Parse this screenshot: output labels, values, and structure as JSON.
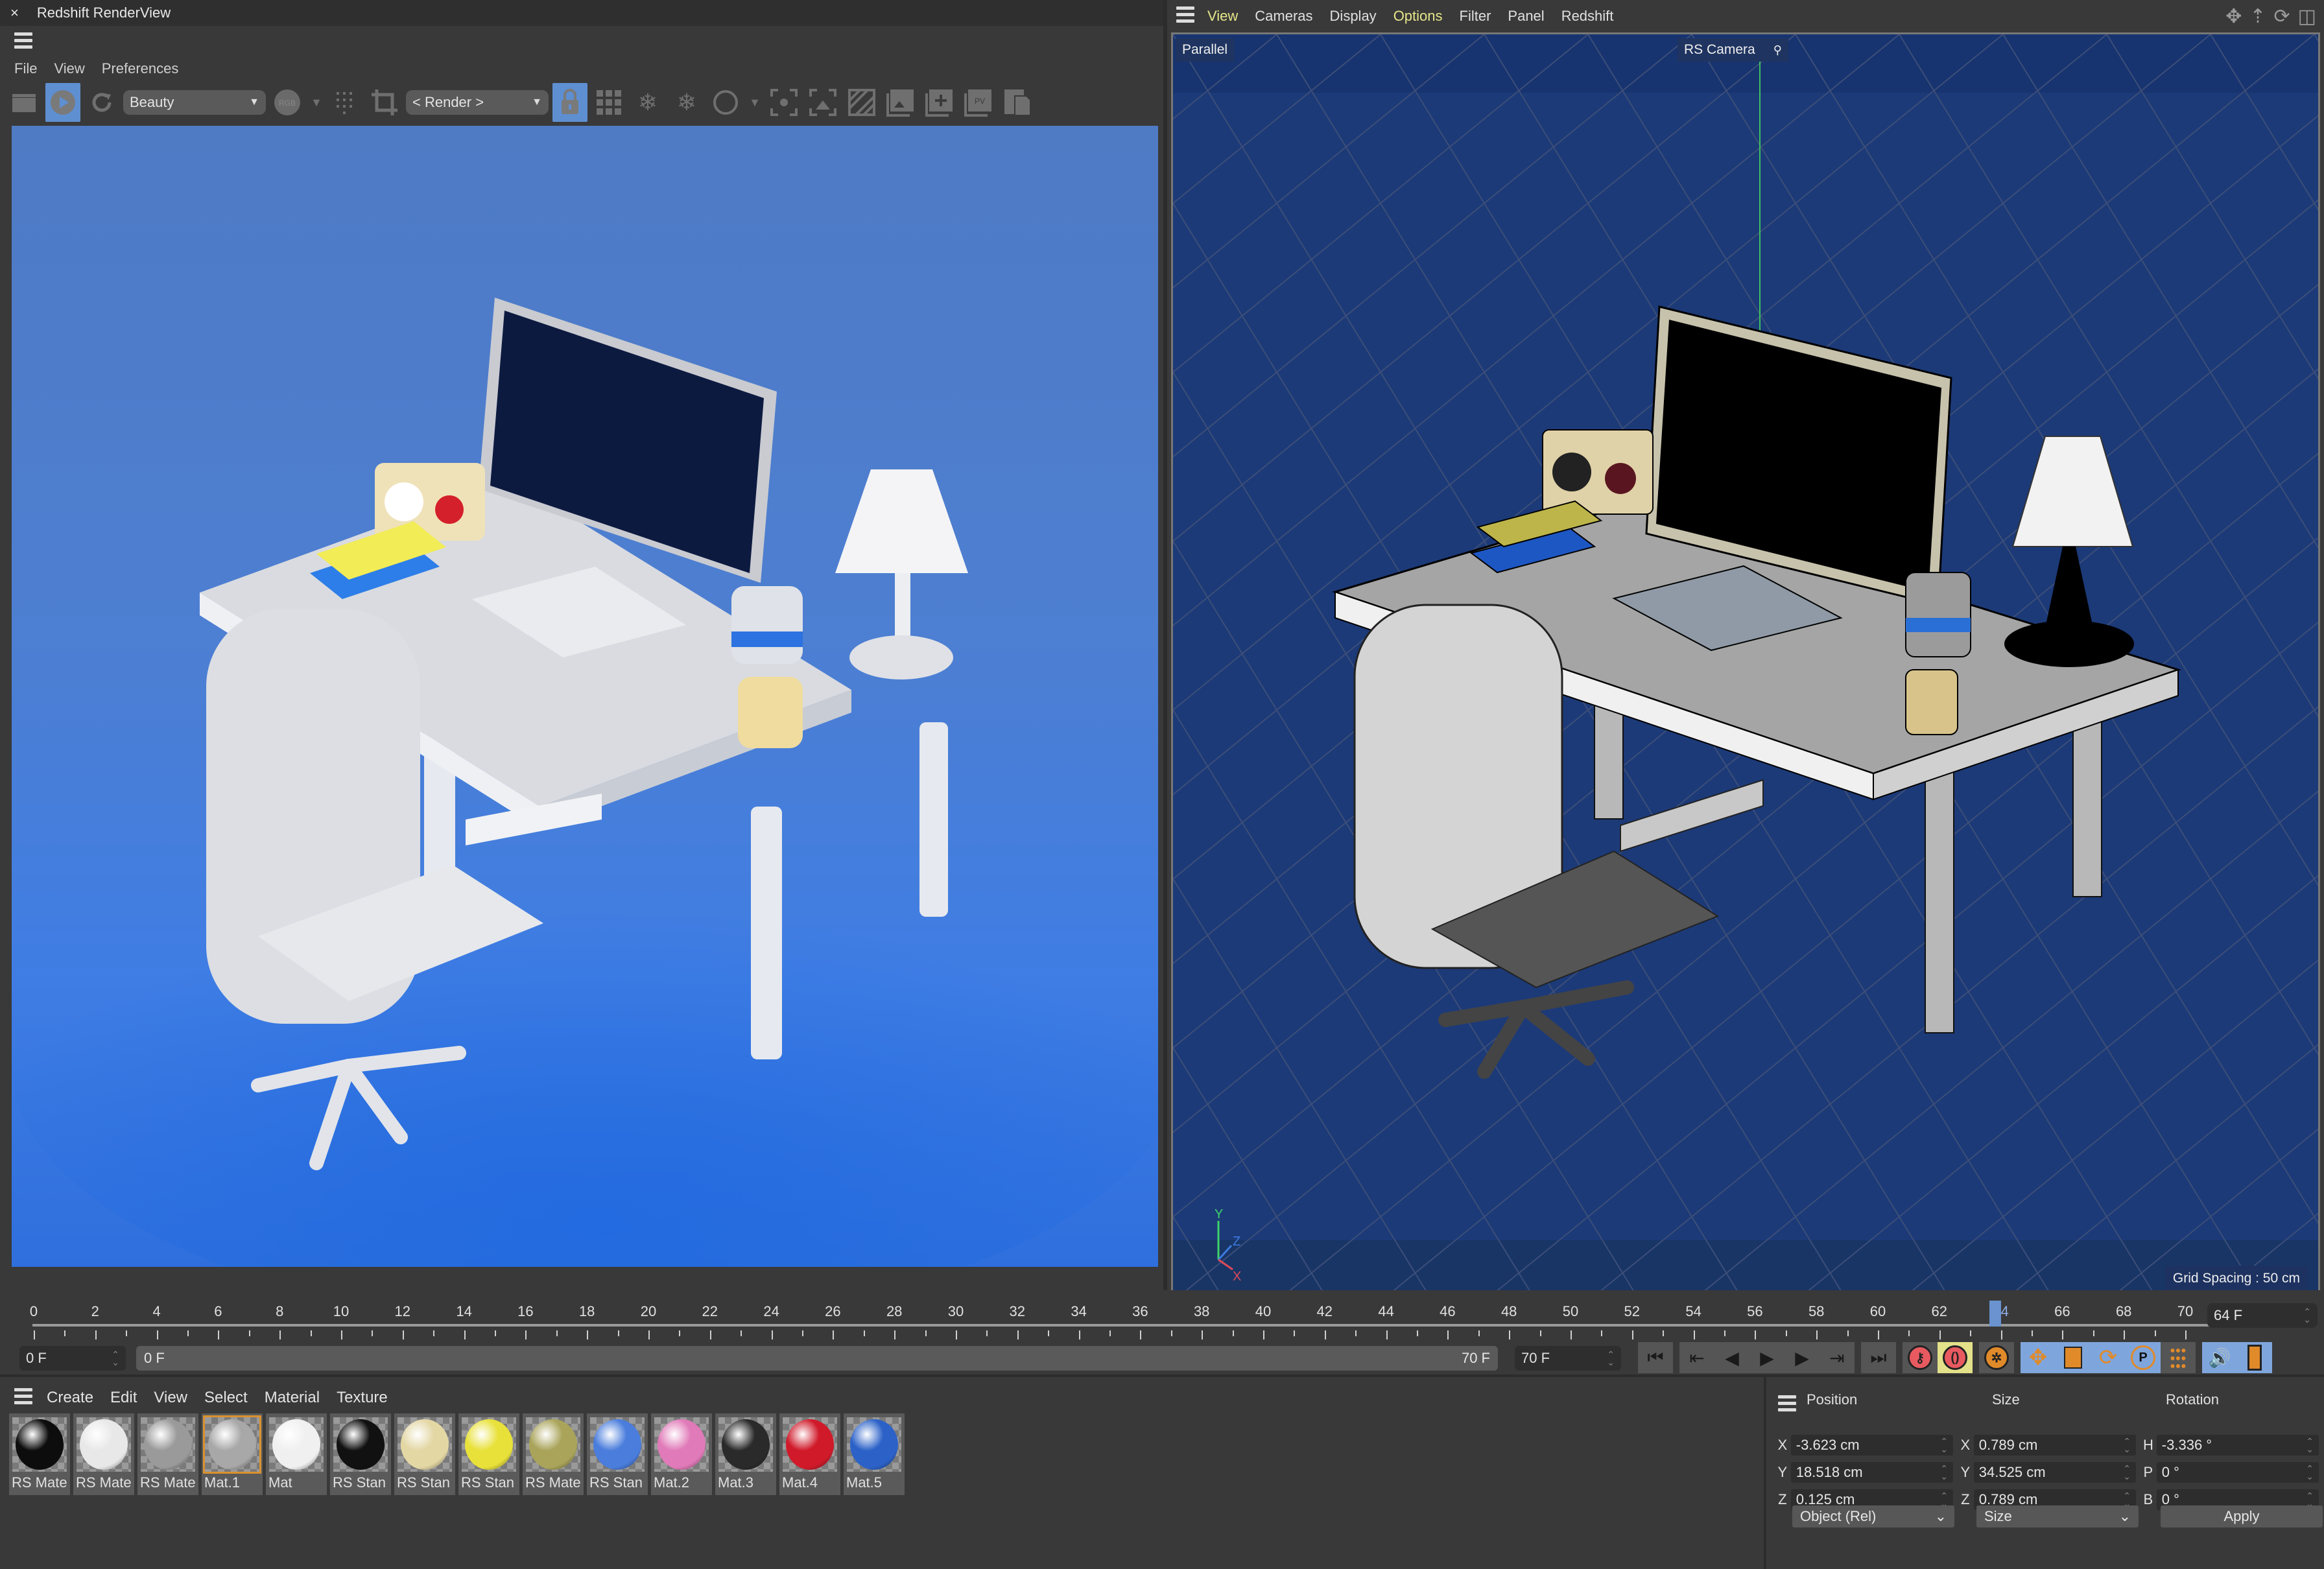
{
  "render_view": {
    "title": "Redshift RenderView",
    "close_icon": "close-icon",
    "menu": [
      "File",
      "View",
      "Preferences"
    ],
    "toolbar": {
      "aov_select": "Beauty",
      "camera_select": "< Render >",
      "icons": [
        "clapper-icon",
        "play-render-icon",
        "refresh-icon",
        "aov-dropdown",
        "rgb-icon",
        "grid-dots-icon",
        "crop-icon",
        "render-camera-dropdown",
        "lock-icon",
        "grid-icon",
        "snowflake-icon",
        "snowflake-g-icon",
        "circle-icon",
        "focus-icon",
        "fit-icon",
        "stripes-icon",
        "snapshot-icon",
        "add-snapshot-icon",
        "pv-icon",
        "copy-icon"
      ],
      "active": [
        "play-render-icon",
        "lock-icon"
      ]
    }
  },
  "viewport": {
    "menu": [
      {
        "label": "View",
        "highlight": true
      },
      {
        "label": "Cameras",
        "highlight": false
      },
      {
        "label": "Display",
        "highlight": false
      },
      {
        "label": "Options",
        "highlight": true
      },
      {
        "label": "Filter",
        "highlight": false
      },
      {
        "label": "Panel",
        "highlight": false
      },
      {
        "label": "Redshift",
        "highlight": false
      }
    ],
    "nav_icons": [
      "move-view-icon",
      "dolly-icon",
      "rotate-view-icon",
      "layout-icon"
    ],
    "projection_label": "Parallel",
    "camera_label": "RS Camera",
    "grid_spacing": "Grid Spacing : 50 cm",
    "axis_labels": [
      "Y",
      "Z",
      "X"
    ]
  },
  "timeline": {
    "ticks": [
      0,
      2,
      4,
      6,
      8,
      10,
      12,
      14,
      16,
      18,
      20,
      22,
      24,
      26,
      28,
      30,
      32,
      34,
      36,
      38,
      40,
      42,
      44,
      46,
      48,
      50,
      52,
      54,
      56,
      58,
      60,
      62,
      64,
      66,
      68,
      70
    ],
    "current_frame_value": 64,
    "current_frame": "64 F",
    "start_field": "0 F",
    "range_start": "0 F",
    "range_end": "70 F",
    "end_field": "70 F",
    "transport": [
      "go-to-start-icon",
      "prev-key-icon",
      "prev-frame-icon",
      "play-icon",
      "next-frame-icon",
      "next-key-icon",
      "go-to-end-icon"
    ],
    "record_buttons": [
      "record-active-icon",
      "autokey-icon"
    ],
    "key_buttons": [
      "keyframe-selection-icon",
      "position-key-icon",
      "scale-key-icon",
      "rotation-key-icon",
      "parameter-key-icon",
      "point-level-icon"
    ],
    "extra_buttons": [
      "sound-icon",
      "film-icon"
    ]
  },
  "material_manager": {
    "menu": [
      "Create",
      "Edit",
      "View",
      "Select",
      "Material",
      "Texture"
    ],
    "selected_index": 3,
    "materials": [
      {
        "name": "RS Mate",
        "color": "#0d0d0d"
      },
      {
        "name": "RS Mate",
        "color": "#e8e8e8"
      },
      {
        "name": "RS Mate",
        "color": "#9a9a9a"
      },
      {
        "name": "Mat.1",
        "color": "#a8a8a8"
      },
      {
        "name": "Mat",
        "color": "#f0f0f0"
      },
      {
        "name": "RS Stan",
        "color": "#111111"
      },
      {
        "name": "RS Stan",
        "color": "#e3d7a4"
      },
      {
        "name": "RS Stan",
        "color": "#e8e13a"
      },
      {
        "name": "RS Mate",
        "color": "#a9a45a"
      },
      {
        "name": "RS Stan",
        "color": "#4a7ddc"
      },
      {
        "name": "Mat.2",
        "color": "#e07ab8"
      },
      {
        "name": "Mat.3",
        "color": "#2a2a2a"
      },
      {
        "name": "Mat.4",
        "color": "#d01a2a"
      },
      {
        "name": "Mat.5",
        "color": "#2c62c8"
      }
    ]
  },
  "attributes": {
    "headers": {
      "position": "Position",
      "size": "Size",
      "rotation": "Rotation"
    },
    "rows": [
      {
        "pos_axis": "X",
        "pos": "-3.623 cm",
        "size_axis": "X",
        "size": "0.789 cm",
        "rot_axis": "H",
        "rot": "-3.336 °"
      },
      {
        "pos_axis": "Y",
        "pos": "18.518 cm",
        "size_axis": "Y",
        "size": "34.525 cm",
        "rot_axis": "P",
        "rot": "0 °"
      },
      {
        "pos_axis": "Z",
        "pos": "0.125 cm",
        "size_axis": "Z",
        "size": "0.789 cm",
        "rot_axis": "B",
        "rot": "0 °"
      }
    ],
    "coord_mode": "Object (Rel)",
    "size_mode": "Size",
    "apply_label": "Apply"
  }
}
